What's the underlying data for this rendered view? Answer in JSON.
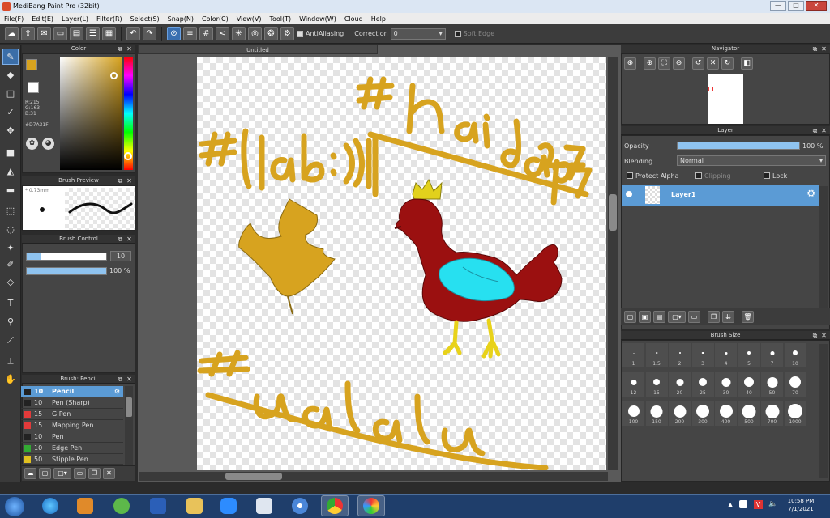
{
  "window": {
    "title": "MediBang Paint Pro (32bit)",
    "min": "—",
    "max": "□",
    "close": "✕"
  },
  "menu": [
    "File(F)",
    "Edit(E)",
    "Layer(L)",
    "Filter(R)",
    "Select(S)",
    "Snap(N)",
    "Color(C)",
    "View(V)",
    "Tool(T)",
    "Window(W)",
    "Cloud",
    "Help"
  ],
  "toolbar": {
    "antialiasing": "AntiAliasing",
    "correction_label": "Correction",
    "correction_value": "0",
    "soft_edge": "Soft Edge"
  },
  "color_panel": {
    "title": "Color",
    "r": "R:215",
    "g": "G:163",
    "b": "B:31",
    "hex": "#D7A31F",
    "fg": "#D7A31F",
    "bg": "#FFFFFF"
  },
  "brush_preview": {
    "title": "Brush Preview",
    "size": "0.73mm"
  },
  "brush_control": {
    "title": "Brush Control",
    "size": "10",
    "opacity": "100 %",
    "opacity_fraction": 1.0
  },
  "brush_list": {
    "title": "Brush: Pencil",
    "items": [
      {
        "size": "10",
        "name": "Pencil",
        "color": "#222222"
      },
      {
        "size": "10",
        "name": "Pen (Sharp)",
        "color": "#222222"
      },
      {
        "size": "15",
        "name": "G Pen",
        "color": "#e33a3a"
      },
      {
        "size": "15",
        "name": "Mapping Pen",
        "color": "#e33a3a"
      },
      {
        "size": "10",
        "name": "Pen",
        "color": "#222222"
      },
      {
        "size": "10",
        "name": "Edge Pen",
        "color": "#33aa33"
      },
      {
        "size": "50",
        "name": "Stipple Pen",
        "color": "#e0c020"
      }
    ]
  },
  "document": {
    "tab": "Untitled"
  },
  "navigator": {
    "title": "Navigator"
  },
  "layer_panel": {
    "title": "Layer",
    "opacity_label": "Opacity",
    "opacity_value": "100 %",
    "opacity_fraction": 1.0,
    "blending_label": "Blending",
    "blending_value": "Normal",
    "protect_alpha": "Protect Alpha",
    "clipping": "Clipping",
    "lock": "Lock",
    "layers": [
      {
        "name": "Layer1"
      }
    ]
  },
  "brush_size_panel": {
    "title": "Brush Size",
    "sizes": [
      "1",
      "1.5",
      "2",
      "3",
      "4",
      "5",
      "7",
      "10",
      "12",
      "15",
      "20",
      "25",
      "30",
      "40",
      "50",
      "70",
      "100",
      "150",
      "200",
      "300",
      "400",
      "500",
      "700",
      "1000"
    ]
  },
  "taskbar": {
    "time": "10:58 PM",
    "date": "7/1/2021"
  },
  "colors": {
    "accent": "#5b9bd5",
    "panel": "#454545",
    "paint_gold": "#D7A31F",
    "rooster_red": "#9B1010",
    "wing_cyan": "#27E0F0",
    "leg_yellow": "#F5E01A"
  }
}
